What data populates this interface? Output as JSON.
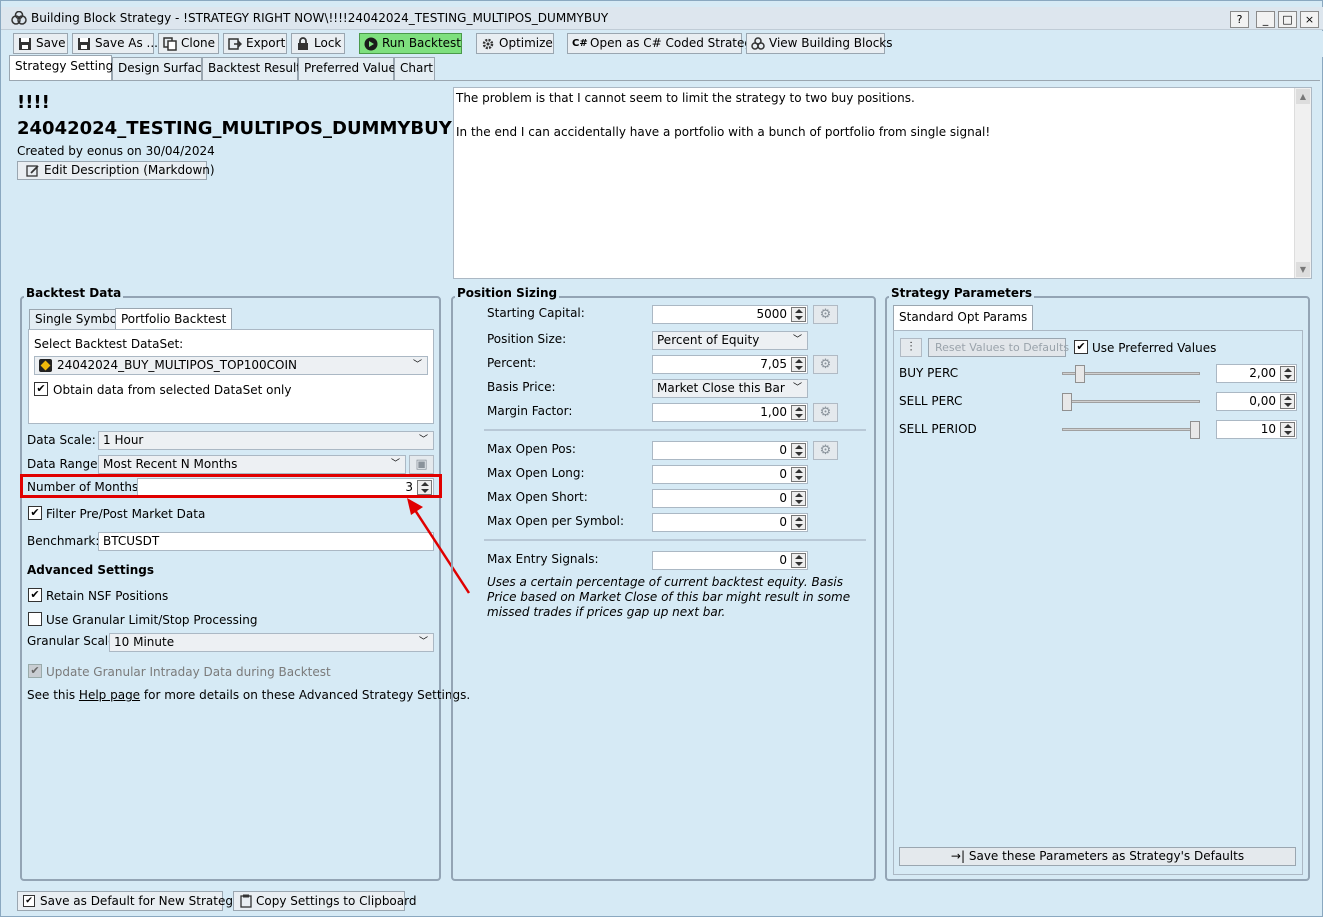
{
  "window": {
    "title": "Building Block Strategy - !STRATEGY RIGHT NOW\\!!!!24042024_TESTING_MULTIPOS_DUMMYBUY",
    "controls": [
      "?",
      "_",
      "□",
      "×"
    ]
  },
  "toolbar": {
    "save": "Save",
    "save_as": "Save As ...",
    "clone": "Clone",
    "export": "Export",
    "lock": "Lock",
    "run_backtest": "Run Backtest",
    "optimize": "Optimize",
    "open_csharp": "Open as C# Coded Strategy",
    "view_blocks": "View Building Blocks"
  },
  "tabs": [
    "Strategy Settings",
    "Design Surface",
    "Backtest Results",
    "Preferred Values",
    "Chart"
  ],
  "header": {
    "title_line1": "!!!!",
    "title_line2": "24042024_TESTING_MULTIPOS_DUMMYBUY",
    "created": "Created by eonus on 30/04/2024",
    "edit_desc": "Edit Description (Markdown)",
    "description_line1": "The problem is that I cannot seem to limit the strategy to two buy positions.",
    "description_line2": "In the end I can accidentally have a portfolio with a bunch of portfolio from single signal!"
  },
  "backtest": {
    "title": "Backtest Data",
    "tab_single": "Single Symbol",
    "tab_portfolio": "Portfolio Backtest",
    "select_label": "Select Backtest DataSet:",
    "dataset": "24042024_BUY_MULTIPOS_TOP100COIN",
    "obtain_only": "Obtain data from selected DataSet only",
    "scale_label": "Data Scale:",
    "scale_value": "1 Hour",
    "range_label": "Data Range:",
    "range_value": "Most Recent N Months",
    "months_label": "Number of Months:",
    "months_value": "3",
    "filter_label": "Filter Pre/Post Market Data",
    "benchmark_label": "Benchmark:",
    "benchmark_value": "BTCUSDT",
    "advanced_title": "Advanced Settings",
    "retain_nsf": "Retain NSF Positions",
    "granular_proc": "Use Granular Limit/Stop Processing",
    "granular_scale_label": "Granular Scale",
    "granular_scale_value": "10 Minute",
    "update_granular": "Update Granular Intraday Data during Backtest",
    "see_this": "See this",
    "help_page": "Help page",
    "help_rest": "for more details on these Advanced Strategy Settings."
  },
  "sizing": {
    "title": "Position Sizing",
    "starting_capital_label": "Starting Capital:",
    "starting_capital": "5000",
    "position_size_label": "Position Size:",
    "position_size": "Percent of Equity",
    "percent_label": "Percent:",
    "percent": "7,05",
    "basis_label": "Basis Price:",
    "basis": "Market Close this Bar",
    "margin_label": "Margin Factor:",
    "margin": "1,00",
    "max_open_label": "Max Open Pos:",
    "max_open": "0",
    "max_long_label": "Max Open Long:",
    "max_long": "0",
    "max_short_label": "Max Open Short:",
    "max_short": "0",
    "max_symbol_label": "Max Open per Symbol:",
    "max_symbol": "0",
    "max_entry_label": "Max Entry Signals:",
    "max_entry": "0",
    "note_line1": "Uses a certain percentage of current backtest equity. Basis",
    "note_line2": "Price based on Market Close of this bar might result in some",
    "note_line3": "missed trades if prices gap up next bar."
  },
  "params": {
    "title": "Strategy Parameters",
    "tab": "Standard Opt Params",
    "reset": "Reset Values to Defaults",
    "use_preferred": "Use Preferred Values",
    "items": [
      {
        "name": "BUY PERC",
        "value": "2,00",
        "level": 0.1
      },
      {
        "name": "SELL PERC",
        "value": "0,00",
        "level": 0.0
      },
      {
        "name": "SELL PERIOD",
        "value": "10",
        "level": 1.0
      }
    ],
    "save_defaults": "Save these Parameters as Strategy's Defaults"
  },
  "footer": {
    "save_default": "Save as Default for New Strategies",
    "copy_settings": "Copy Settings to Clipboard"
  },
  "colors": {
    "highlight": "#e00000",
    "run_green": "#7ee07e",
    "background": "#d6eaf5"
  }
}
